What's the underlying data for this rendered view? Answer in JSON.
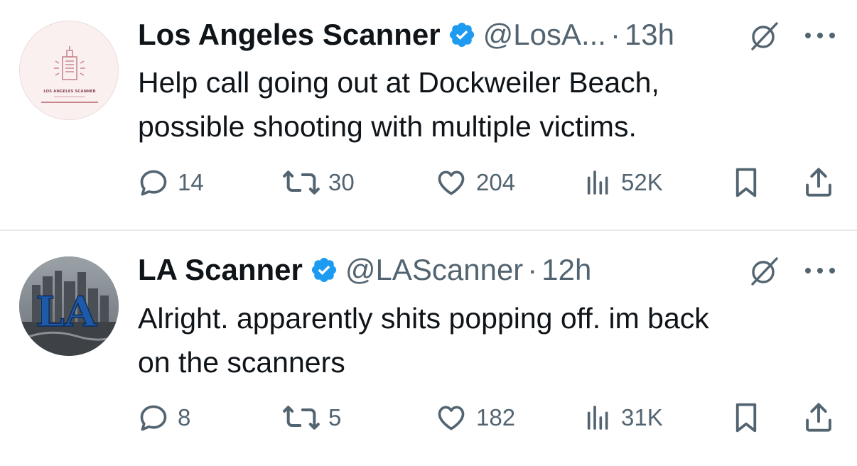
{
  "tweets": [
    {
      "display_name": "Los Angeles Scanner",
      "handle": "@LosA...",
      "separator": "·",
      "time": "13h",
      "text_lines": [
        "Help call going out at Dockweiler Beach,",
        "possible shooting with multiple victims."
      ],
      "avatar_label": "LOS ANGELES SCANNER",
      "stats": {
        "replies": "14",
        "reposts": "30",
        "likes": "204",
        "views": "52K"
      }
    },
    {
      "display_name": "LA Scanner",
      "handle": "@LAScanner",
      "separator": "·",
      "time": "12h",
      "text_lines": [
        "Alright. apparently shits popping off. im back",
        "on the scanners"
      ],
      "avatar_label": "LA",
      "stats": {
        "replies": "8",
        "reposts": "5",
        "likes": "182",
        "views": "31K"
      }
    }
  ],
  "colors": {
    "verified": "#1d9bf0",
    "muted": "#536471",
    "text": "#0f1419",
    "divider": "#e6e8ea"
  },
  "icons": [
    "verified-badge-icon",
    "grok-icon",
    "more-icon",
    "reply-icon",
    "repost-icon",
    "like-icon",
    "views-icon",
    "bookmark-icon",
    "share-icon"
  ]
}
